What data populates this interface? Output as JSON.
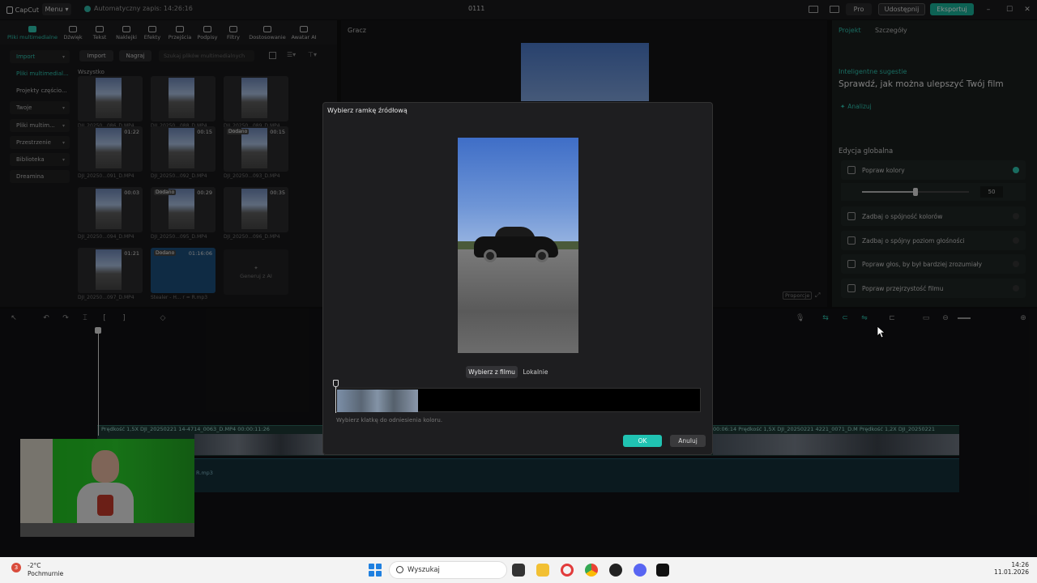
{
  "titlebar": {
    "app_name": "CapCut",
    "menu_label": "Menu",
    "autosave": "Automatyczny zapis: 14:26:16",
    "project_title": "0111",
    "pro_label": "Pro",
    "share_label": "Udostępnij",
    "export_label": "Eksportuj"
  },
  "media_tabs": [
    {
      "label": "Pliki multimedialne",
      "icon": "media-icon"
    },
    {
      "label": "Dźwięk",
      "icon": "audio-icon"
    },
    {
      "label": "Tekst",
      "icon": "text-icon"
    },
    {
      "label": "Naklejki",
      "icon": "sticker-icon"
    },
    {
      "label": "Efekty",
      "icon": "effects-icon"
    },
    {
      "label": "Przejścia",
      "icon": "transitions-icon"
    },
    {
      "label": "Podpisy",
      "icon": "captions-icon"
    },
    {
      "label": "Filtry",
      "icon": "filters-icon"
    },
    {
      "label": "Dostosowanie",
      "icon": "adjust-icon"
    },
    {
      "label": "Awatar AI",
      "icon": "avatar-icon"
    }
  ],
  "media_sidebar": [
    {
      "label": "Import"
    },
    {
      "label": "Pliki multimedial..."
    },
    {
      "label": "Projekty częścio..."
    },
    {
      "label": "Twoje"
    },
    {
      "label": "Pliki multim..."
    },
    {
      "label": "Przestrzenie"
    },
    {
      "label": "Biblioteka"
    },
    {
      "label": "Dreamina"
    }
  ],
  "media_toolbar": {
    "import_label": "Import",
    "record_label": "Nagraj",
    "search_placeholder": "Szukaj plików multimedialnych"
  },
  "media_all_label": "Wszystko",
  "media_items": [
    {
      "name": "DJI_20250...086_D.MP4",
      "duration": "",
      "badge": ""
    },
    {
      "name": "DJI_20250...088_D.MP4",
      "duration": "",
      "badge": ""
    },
    {
      "name": "DJI_20250...089_D.MP4",
      "duration": "",
      "badge": ""
    },
    {
      "name": "DJI_20250...091_D.MP4",
      "duration": "01:22",
      "badge": ""
    },
    {
      "name": "DJI_20250...092_D.MP4",
      "duration": "00:15",
      "badge": ""
    },
    {
      "name": "DJI_20250...093_D.MP4",
      "duration": "00:15",
      "badge": "Dodano"
    },
    {
      "name": "DJI_20250...094_D.MP4",
      "duration": "00:03",
      "badge": ""
    },
    {
      "name": "DJI_20250...095_D.MP4",
      "duration": "00:29",
      "badge": "Dodano"
    },
    {
      "name": "DJI_20250...096_D.MP4",
      "duration": "00:35",
      "badge": ""
    },
    {
      "name": "DJI_20250...097_D.MP4",
      "duration": "01:21",
      "badge": ""
    },
    {
      "name": "Stealer - H... r = R.mp3",
      "duration": "01:16:06",
      "badge": "Dodano"
    }
  ],
  "generate_ai_label": "Generuj z AI",
  "player": {
    "title": "Gracz",
    "ratio_label": "Proporcje"
  },
  "right_panel": {
    "tab_project": "Projekt",
    "tab_details": "Szczegóły",
    "smart_label": "Inteligentne sugestie",
    "smart_title": "Sprawdź, jak można ulepszyć Twój film",
    "analyze_label": "Analizuj",
    "global_label": "Edycja globalna",
    "rows": [
      {
        "label": "Popraw kolory",
        "on": true
      },
      {
        "label": "Zadbaj o spójność kolorów",
        "on": false
      },
      {
        "label": "Zadbaj o spójny poziom głośności",
        "on": false
      },
      {
        "label": "Popraw głos, by był bardziej zrozumiały",
        "on": false
      },
      {
        "label": "Popraw przejrzystość filmu",
        "on": false
      }
    ],
    "slider_value": "50",
    "slider_fraction": 0.5
  },
  "timeline": {
    "video_label_1": "Prędkość 1,5X  DJI_20250221 14-4714_0063_D.MP4  00:00:11:26",
    "video_label_2": "00:06:14   Prędkość 1,5X  DJI_20250221 4221_0071_D.M   Prędkość 1,2X  DJI_20250221",
    "audio_label": "R.mp3"
  },
  "modal": {
    "title": "Wybierz ramkę źródłową",
    "seg_film": "Wybierz z filmu",
    "seg_local": "Lokalnie",
    "hint": "Wybierz klatkę do odniesienia koloru.",
    "ok_label": "OK",
    "cancel_label": "Anuluj"
  },
  "taskbar": {
    "weather_badge": "3",
    "temperature": "-2°C",
    "condition": "Pochmurnie",
    "search_label": "Wyszukaj",
    "time": "14:26",
    "date": "11.01.2026"
  },
  "colors": {
    "accent": "#20c3b2",
    "taskbar": "#f3f3f3"
  }
}
